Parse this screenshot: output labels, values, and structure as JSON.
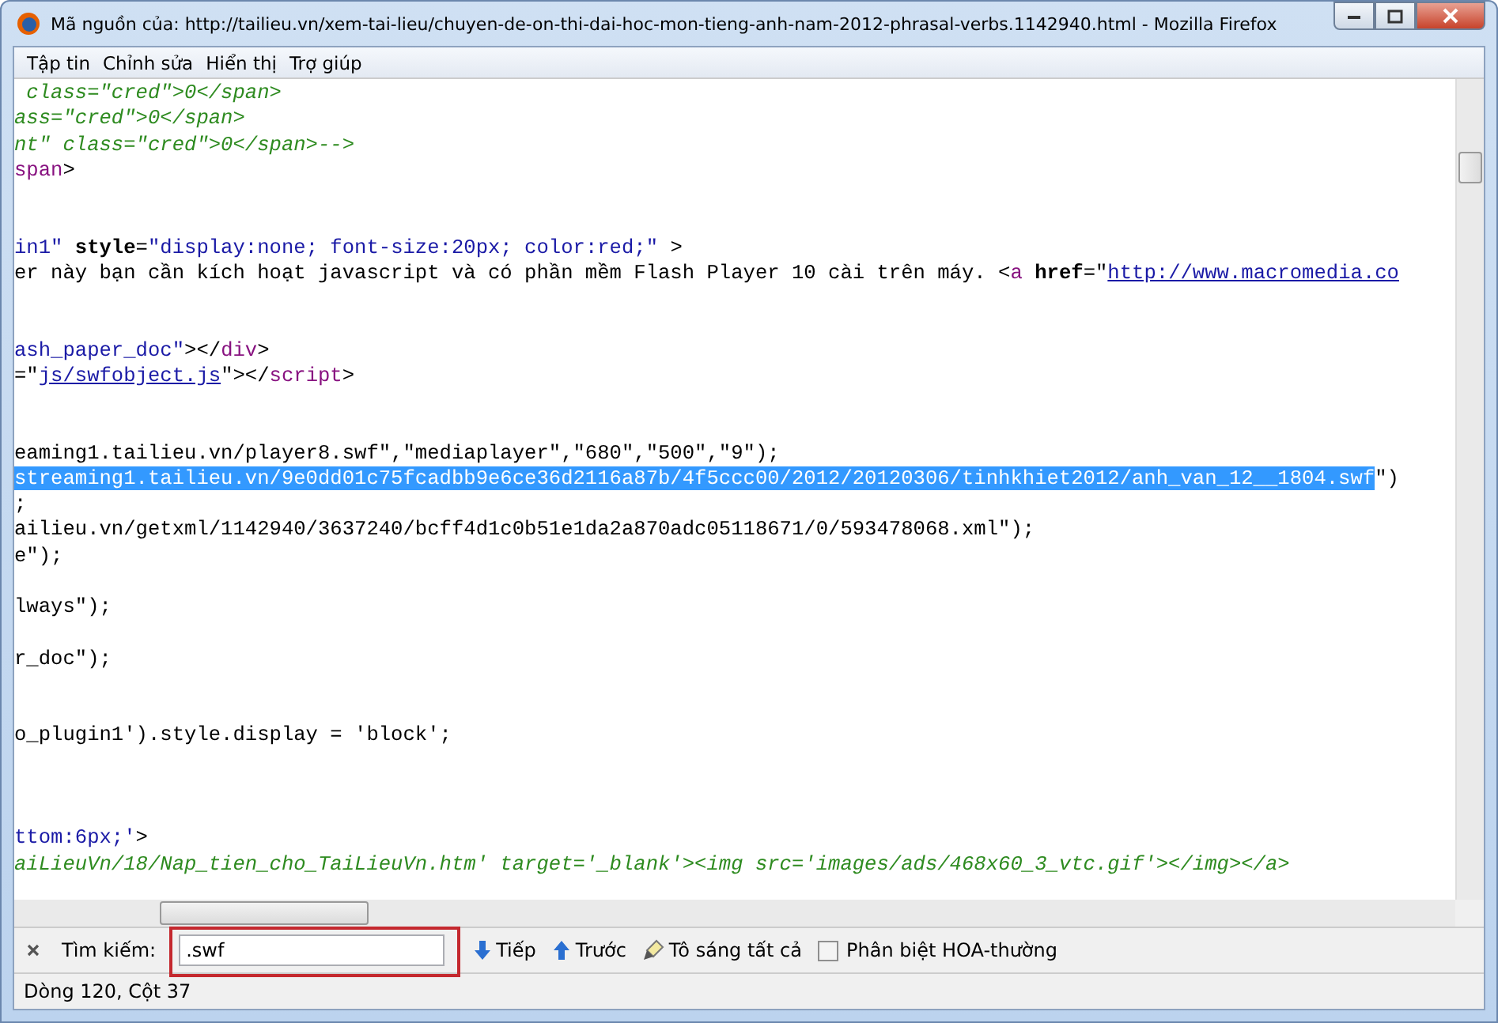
{
  "window": {
    "title": "Mã nguồn của: http://tailieu.vn/xem-tai-lieu/chuyen-de-on-thi-dai-hoc-mon-tieng-anh-nam-2012-phrasal-verbs.1142940.html - Mozilla Firefox"
  },
  "menu": [
    {
      "label": "Tập tin"
    },
    {
      "label": "Chỉnh sửa"
    },
    {
      "label": "Hiển thị"
    },
    {
      "label": "Trợ giúp"
    }
  ],
  "source_lines": [
    {
      "blank": false,
      "segments": [
        {
          "kind": "comment",
          "text": " class=\"cred\">0</span>"
        }
      ]
    },
    {
      "blank": false,
      "segments": [
        {
          "kind": "comment",
          "text": "ass=\"cred\">0</span>"
        }
      ]
    },
    {
      "blank": false,
      "segments": [
        {
          "kind": "comment",
          "text": "nt\" class=\"cred\">0</span>-->"
        }
      ]
    },
    {
      "blank": false,
      "segments": [
        {
          "kind": "tag",
          "text": "span"
        },
        {
          "kind": "plain",
          "text": ">"
        }
      ]
    },
    {
      "blank": true
    },
    {
      "blank": true
    },
    {
      "blank": false,
      "segments": [
        {
          "kind": "value",
          "text": "in1\""
        },
        {
          "kind": "attr",
          "text": " style"
        },
        {
          "kind": "plain",
          "text": "="
        },
        {
          "kind": "value",
          "text": "\"display:none; font-size:20px; color:red;\""
        },
        {
          "kind": "plain",
          "text": " >"
        }
      ]
    },
    {
      "blank": false,
      "segments": [
        {
          "kind": "plain",
          "text": "er này bạn cần kích hoạt javascript và có phần mềm Flash Player 10 cài trên máy. <"
        },
        {
          "kind": "tag",
          "text": "a"
        },
        {
          "kind": "attr",
          "text": " href"
        },
        {
          "kind": "plain",
          "text": "=\""
        },
        {
          "kind": "link",
          "text": "http://www.macromedia.co"
        }
      ]
    },
    {
      "blank": true
    },
    {
      "blank": true
    },
    {
      "blank": false,
      "segments": [
        {
          "kind": "value",
          "text": "ash_paper_doc\""
        },
        {
          "kind": "plain",
          "text": "></"
        },
        {
          "kind": "tag",
          "text": "div"
        },
        {
          "kind": "plain",
          "text": ">"
        }
      ]
    },
    {
      "blank": false,
      "segments": [
        {
          "kind": "plain",
          "text": "=\""
        },
        {
          "kind": "link",
          "text": "js/swfobject.js"
        },
        {
          "kind": "plain",
          "text": "\"></"
        },
        {
          "kind": "tag",
          "text": "script"
        },
        {
          "kind": "plain",
          "text": ">"
        }
      ]
    },
    {
      "blank": true
    },
    {
      "blank": true
    },
    {
      "blank": false,
      "segments": [
        {
          "kind": "plain",
          "text": "eaming1.tailieu.vn/player8.swf\",\"mediaplayer\",\"680\",\"500\",\"9\");"
        }
      ]
    },
    {
      "blank": false,
      "segments": [
        {
          "kind": "selected",
          "text": "streaming1.tailieu.vn/9e0dd01c75fcadbb9e6ce36d2116a87b/4f5ccc00/2012/20120306/tinhkhiet2012/anh_van_12__1804.swf"
        },
        {
          "kind": "plain",
          "text": "\")"
        }
      ]
    },
    {
      "blank": false,
      "segments": [
        {
          "kind": "plain",
          "text": ";"
        }
      ]
    },
    {
      "blank": false,
      "segments": [
        {
          "kind": "plain",
          "text": "ailieu.vn/getxml/1142940/3637240/bcff4d1c0b51e1da2a870adc05118671/0/593478068.xml\");"
        }
      ]
    },
    {
      "blank": false,
      "segments": [
        {
          "kind": "plain",
          "text": "e\");"
        }
      ]
    },
    {
      "blank": true
    },
    {
      "blank": false,
      "segments": [
        {
          "kind": "plain",
          "text": "lways\");"
        }
      ]
    },
    {
      "blank": true
    },
    {
      "blank": false,
      "segments": [
        {
          "kind": "plain",
          "text": "r_doc\");"
        }
      ]
    },
    {
      "blank": true
    },
    {
      "blank": true
    },
    {
      "blank": false,
      "segments": [
        {
          "kind": "plain",
          "text": "o_plugin1').style.display = 'block';"
        }
      ]
    },
    {
      "blank": true
    },
    {
      "blank": true
    },
    {
      "blank": true
    },
    {
      "blank": false,
      "segments": [
        {
          "kind": "value",
          "text": "ttom:6px;'"
        },
        {
          "kind": "plain",
          "text": ">"
        }
      ]
    },
    {
      "blank": false,
      "segments": [
        {
          "kind": "comment",
          "text": "aiLieuVn/18/Nap_tien_cho_TaiLieuVn.htm' target='_blank'><img src='images/ads/468x60_3_vtc.gif'></img></a>"
        }
      ]
    }
  ],
  "find_bar": {
    "label": "Tìm kiếm:",
    "value": ".swf",
    "next": "Tiếp",
    "previous": "Trước",
    "highlight_all": "Tô sáng tất cả",
    "match_case": {
      "label": "Phân biệt HOA-thường",
      "checked": false
    }
  },
  "status_bar": "Dòng 120, Cột 37"
}
